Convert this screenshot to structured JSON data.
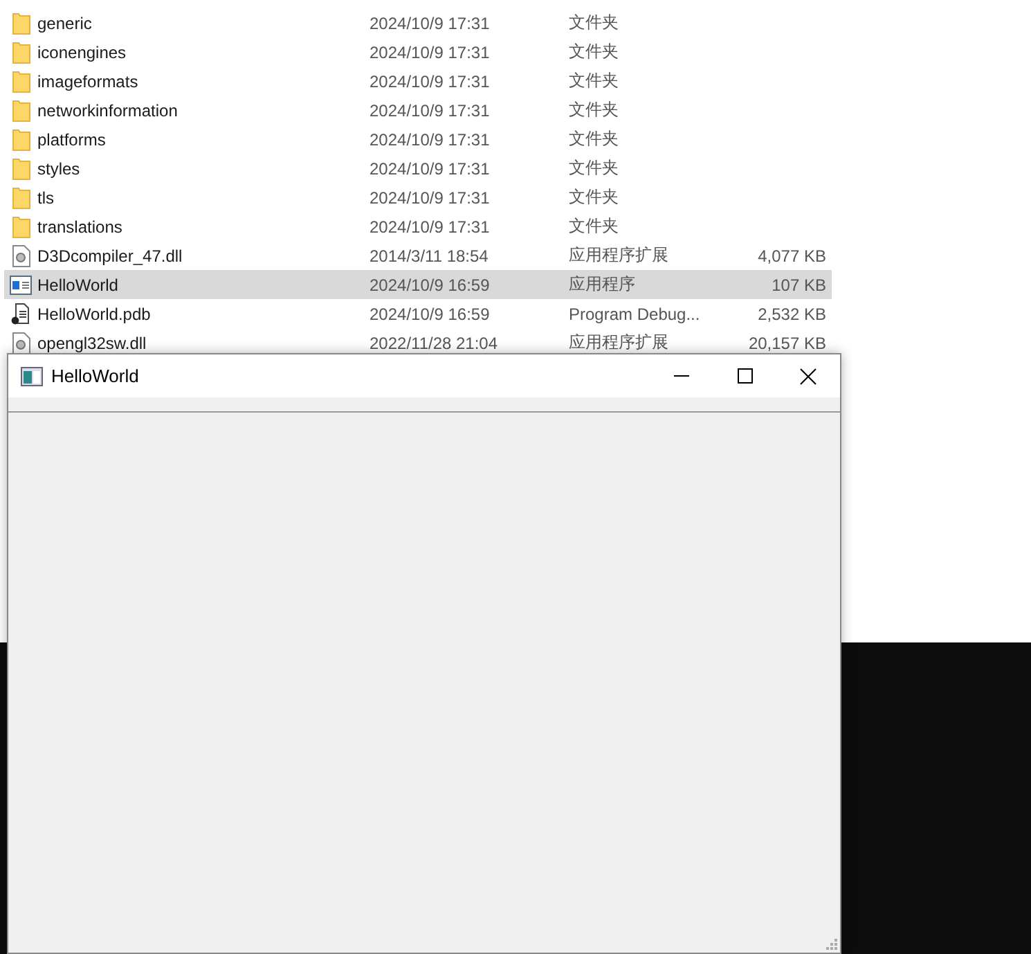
{
  "files": [
    {
      "name": "generic",
      "date": "2024/10/9 17:31",
      "type": "文件夹",
      "kind": "folder",
      "selected": false
    },
    {
      "name": "iconengines",
      "date": "2024/10/9 17:31",
      "type": "文件夹",
      "kind": "folder",
      "selected": false
    },
    {
      "name": "imageformats",
      "date": "2024/10/9 17:31",
      "type": "文件夹",
      "kind": "folder",
      "selected": false
    },
    {
      "name": "networkinformation",
      "date": "2024/10/9 17:31",
      "type": "文件夹",
      "kind": "folder",
      "selected": false
    },
    {
      "name": "platforms",
      "date": "2024/10/9 17:31",
      "type": "文件夹",
      "kind": "folder",
      "selected": false
    },
    {
      "name": "styles",
      "date": "2024/10/9 17:31",
      "type": "文件夹",
      "kind": "folder",
      "selected": false
    },
    {
      "name": "tls",
      "date": "2024/10/9 17:31",
      "type": "文件夹",
      "kind": "folder",
      "selected": false
    },
    {
      "name": "translations",
      "date": "2024/10/9 17:31",
      "type": "文件夹",
      "kind": "folder",
      "selected": false
    },
    {
      "name": "D3Dcompiler_47.dll",
      "date": "2014/3/11 18:54",
      "type": "应用程序扩展",
      "size": "4,077 KB",
      "kind": "dll",
      "selected": false
    },
    {
      "name": "HelloWorld",
      "date": "2024/10/9 16:59",
      "type": "应用程序",
      "size": "107 KB",
      "kind": "app",
      "selected": true
    },
    {
      "name": "HelloWorld.pdb",
      "date": "2024/10/9 16:59",
      "type": "Program Debug...",
      "size": "2,532 KB",
      "kind": "pdb",
      "selected": false
    },
    {
      "name": "opengl32sw.dll",
      "date": "2022/11/28 21:04",
      "type": "应用程序扩展",
      "size": "20,157 KB",
      "kind": "dll",
      "selected": false
    }
  ],
  "window": {
    "title": "HelloWorld"
  }
}
